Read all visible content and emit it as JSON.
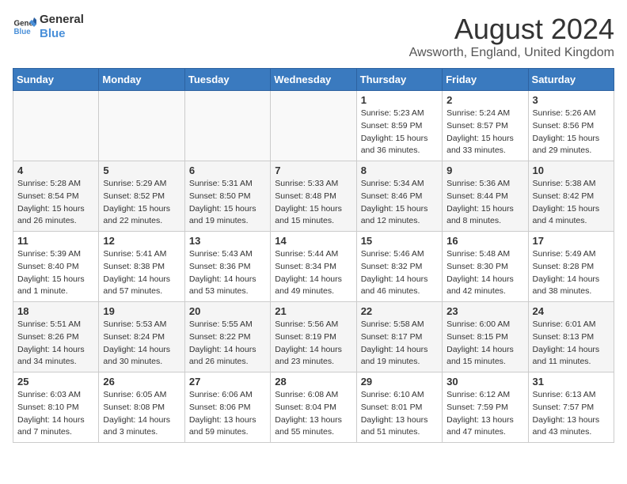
{
  "logo": {
    "line1": "General",
    "line2": "Blue"
  },
  "title": "August 2024",
  "subtitle": "Awsworth, England, United Kingdom",
  "weekdays": [
    "Sunday",
    "Monday",
    "Tuesday",
    "Wednesday",
    "Thursday",
    "Friday",
    "Saturday"
  ],
  "weeks": [
    [
      {
        "day": "",
        "content": ""
      },
      {
        "day": "",
        "content": ""
      },
      {
        "day": "",
        "content": ""
      },
      {
        "day": "",
        "content": ""
      },
      {
        "day": "1",
        "content": "Sunrise: 5:23 AM\nSunset: 8:59 PM\nDaylight: 15 hours\nand 36 minutes."
      },
      {
        "day": "2",
        "content": "Sunrise: 5:24 AM\nSunset: 8:57 PM\nDaylight: 15 hours\nand 33 minutes."
      },
      {
        "day": "3",
        "content": "Sunrise: 5:26 AM\nSunset: 8:56 PM\nDaylight: 15 hours\nand 29 minutes."
      }
    ],
    [
      {
        "day": "4",
        "content": "Sunrise: 5:28 AM\nSunset: 8:54 PM\nDaylight: 15 hours\nand 26 minutes."
      },
      {
        "day": "5",
        "content": "Sunrise: 5:29 AM\nSunset: 8:52 PM\nDaylight: 15 hours\nand 22 minutes."
      },
      {
        "day": "6",
        "content": "Sunrise: 5:31 AM\nSunset: 8:50 PM\nDaylight: 15 hours\nand 19 minutes."
      },
      {
        "day": "7",
        "content": "Sunrise: 5:33 AM\nSunset: 8:48 PM\nDaylight: 15 hours\nand 15 minutes."
      },
      {
        "day": "8",
        "content": "Sunrise: 5:34 AM\nSunset: 8:46 PM\nDaylight: 15 hours\nand 12 minutes."
      },
      {
        "day": "9",
        "content": "Sunrise: 5:36 AM\nSunset: 8:44 PM\nDaylight: 15 hours\nand 8 minutes."
      },
      {
        "day": "10",
        "content": "Sunrise: 5:38 AM\nSunset: 8:42 PM\nDaylight: 15 hours\nand 4 minutes."
      }
    ],
    [
      {
        "day": "11",
        "content": "Sunrise: 5:39 AM\nSunset: 8:40 PM\nDaylight: 15 hours\nand 1 minute."
      },
      {
        "day": "12",
        "content": "Sunrise: 5:41 AM\nSunset: 8:38 PM\nDaylight: 14 hours\nand 57 minutes."
      },
      {
        "day": "13",
        "content": "Sunrise: 5:43 AM\nSunset: 8:36 PM\nDaylight: 14 hours\nand 53 minutes."
      },
      {
        "day": "14",
        "content": "Sunrise: 5:44 AM\nSunset: 8:34 PM\nDaylight: 14 hours\nand 49 minutes."
      },
      {
        "day": "15",
        "content": "Sunrise: 5:46 AM\nSunset: 8:32 PM\nDaylight: 14 hours\nand 46 minutes."
      },
      {
        "day": "16",
        "content": "Sunrise: 5:48 AM\nSunset: 8:30 PM\nDaylight: 14 hours\nand 42 minutes."
      },
      {
        "day": "17",
        "content": "Sunrise: 5:49 AM\nSunset: 8:28 PM\nDaylight: 14 hours\nand 38 minutes."
      }
    ],
    [
      {
        "day": "18",
        "content": "Sunrise: 5:51 AM\nSunset: 8:26 PM\nDaylight: 14 hours\nand 34 minutes."
      },
      {
        "day": "19",
        "content": "Sunrise: 5:53 AM\nSunset: 8:24 PM\nDaylight: 14 hours\nand 30 minutes."
      },
      {
        "day": "20",
        "content": "Sunrise: 5:55 AM\nSunset: 8:22 PM\nDaylight: 14 hours\nand 26 minutes."
      },
      {
        "day": "21",
        "content": "Sunrise: 5:56 AM\nSunset: 8:19 PM\nDaylight: 14 hours\nand 23 minutes."
      },
      {
        "day": "22",
        "content": "Sunrise: 5:58 AM\nSunset: 8:17 PM\nDaylight: 14 hours\nand 19 minutes."
      },
      {
        "day": "23",
        "content": "Sunrise: 6:00 AM\nSunset: 8:15 PM\nDaylight: 14 hours\nand 15 minutes."
      },
      {
        "day": "24",
        "content": "Sunrise: 6:01 AM\nSunset: 8:13 PM\nDaylight: 14 hours\nand 11 minutes."
      }
    ],
    [
      {
        "day": "25",
        "content": "Sunrise: 6:03 AM\nSunset: 8:10 PM\nDaylight: 14 hours\nand 7 minutes."
      },
      {
        "day": "26",
        "content": "Sunrise: 6:05 AM\nSunset: 8:08 PM\nDaylight: 14 hours\nand 3 minutes."
      },
      {
        "day": "27",
        "content": "Sunrise: 6:06 AM\nSunset: 8:06 PM\nDaylight: 13 hours\nand 59 minutes."
      },
      {
        "day": "28",
        "content": "Sunrise: 6:08 AM\nSunset: 8:04 PM\nDaylight: 13 hours\nand 55 minutes."
      },
      {
        "day": "29",
        "content": "Sunrise: 6:10 AM\nSunset: 8:01 PM\nDaylight: 13 hours\nand 51 minutes."
      },
      {
        "day": "30",
        "content": "Sunrise: 6:12 AM\nSunset: 7:59 PM\nDaylight: 13 hours\nand 47 minutes."
      },
      {
        "day": "31",
        "content": "Sunrise: 6:13 AM\nSunset: 7:57 PM\nDaylight: 13 hours\nand 43 minutes."
      }
    ]
  ]
}
